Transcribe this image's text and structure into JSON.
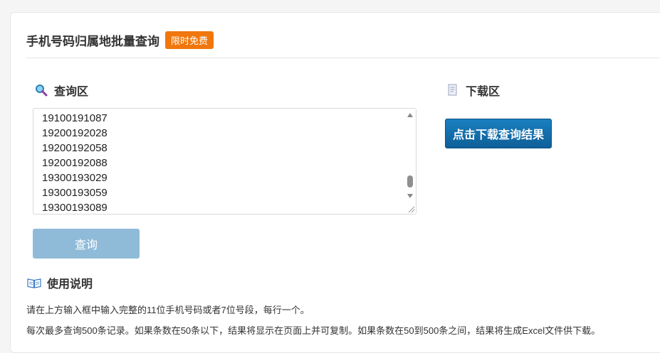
{
  "header": {
    "title": "手机号码归属地批量查询",
    "badge": "限时免费"
  },
  "query_section": {
    "title": "查询区",
    "icon": "search-icon",
    "phone_numbers": [
      "19100191087",
      "19200192028",
      "19200192058",
      "19200192088",
      "19300193029",
      "19300193059",
      "19300193089"
    ],
    "button_label": "查询"
  },
  "download_section": {
    "title": "下载区",
    "icon": "document-icon",
    "button_label": "点击下载查询结果"
  },
  "usage_section": {
    "title": "使用说明",
    "icon": "book-icon",
    "lines": [
      "请在上方输入框中输入完整的11位手机号码或者7位号段，每行一个。",
      "每次最多查询500条记录。如果条数在50条以下，结果将显示在页面上并可复制。如果条数在50到500条之间，结果将生成Excel文件供下载。"
    ]
  },
  "colors": {
    "badge": "#f0770d",
    "download_button": "#12679f",
    "query_button_disabled": "#8fbbd8"
  }
}
